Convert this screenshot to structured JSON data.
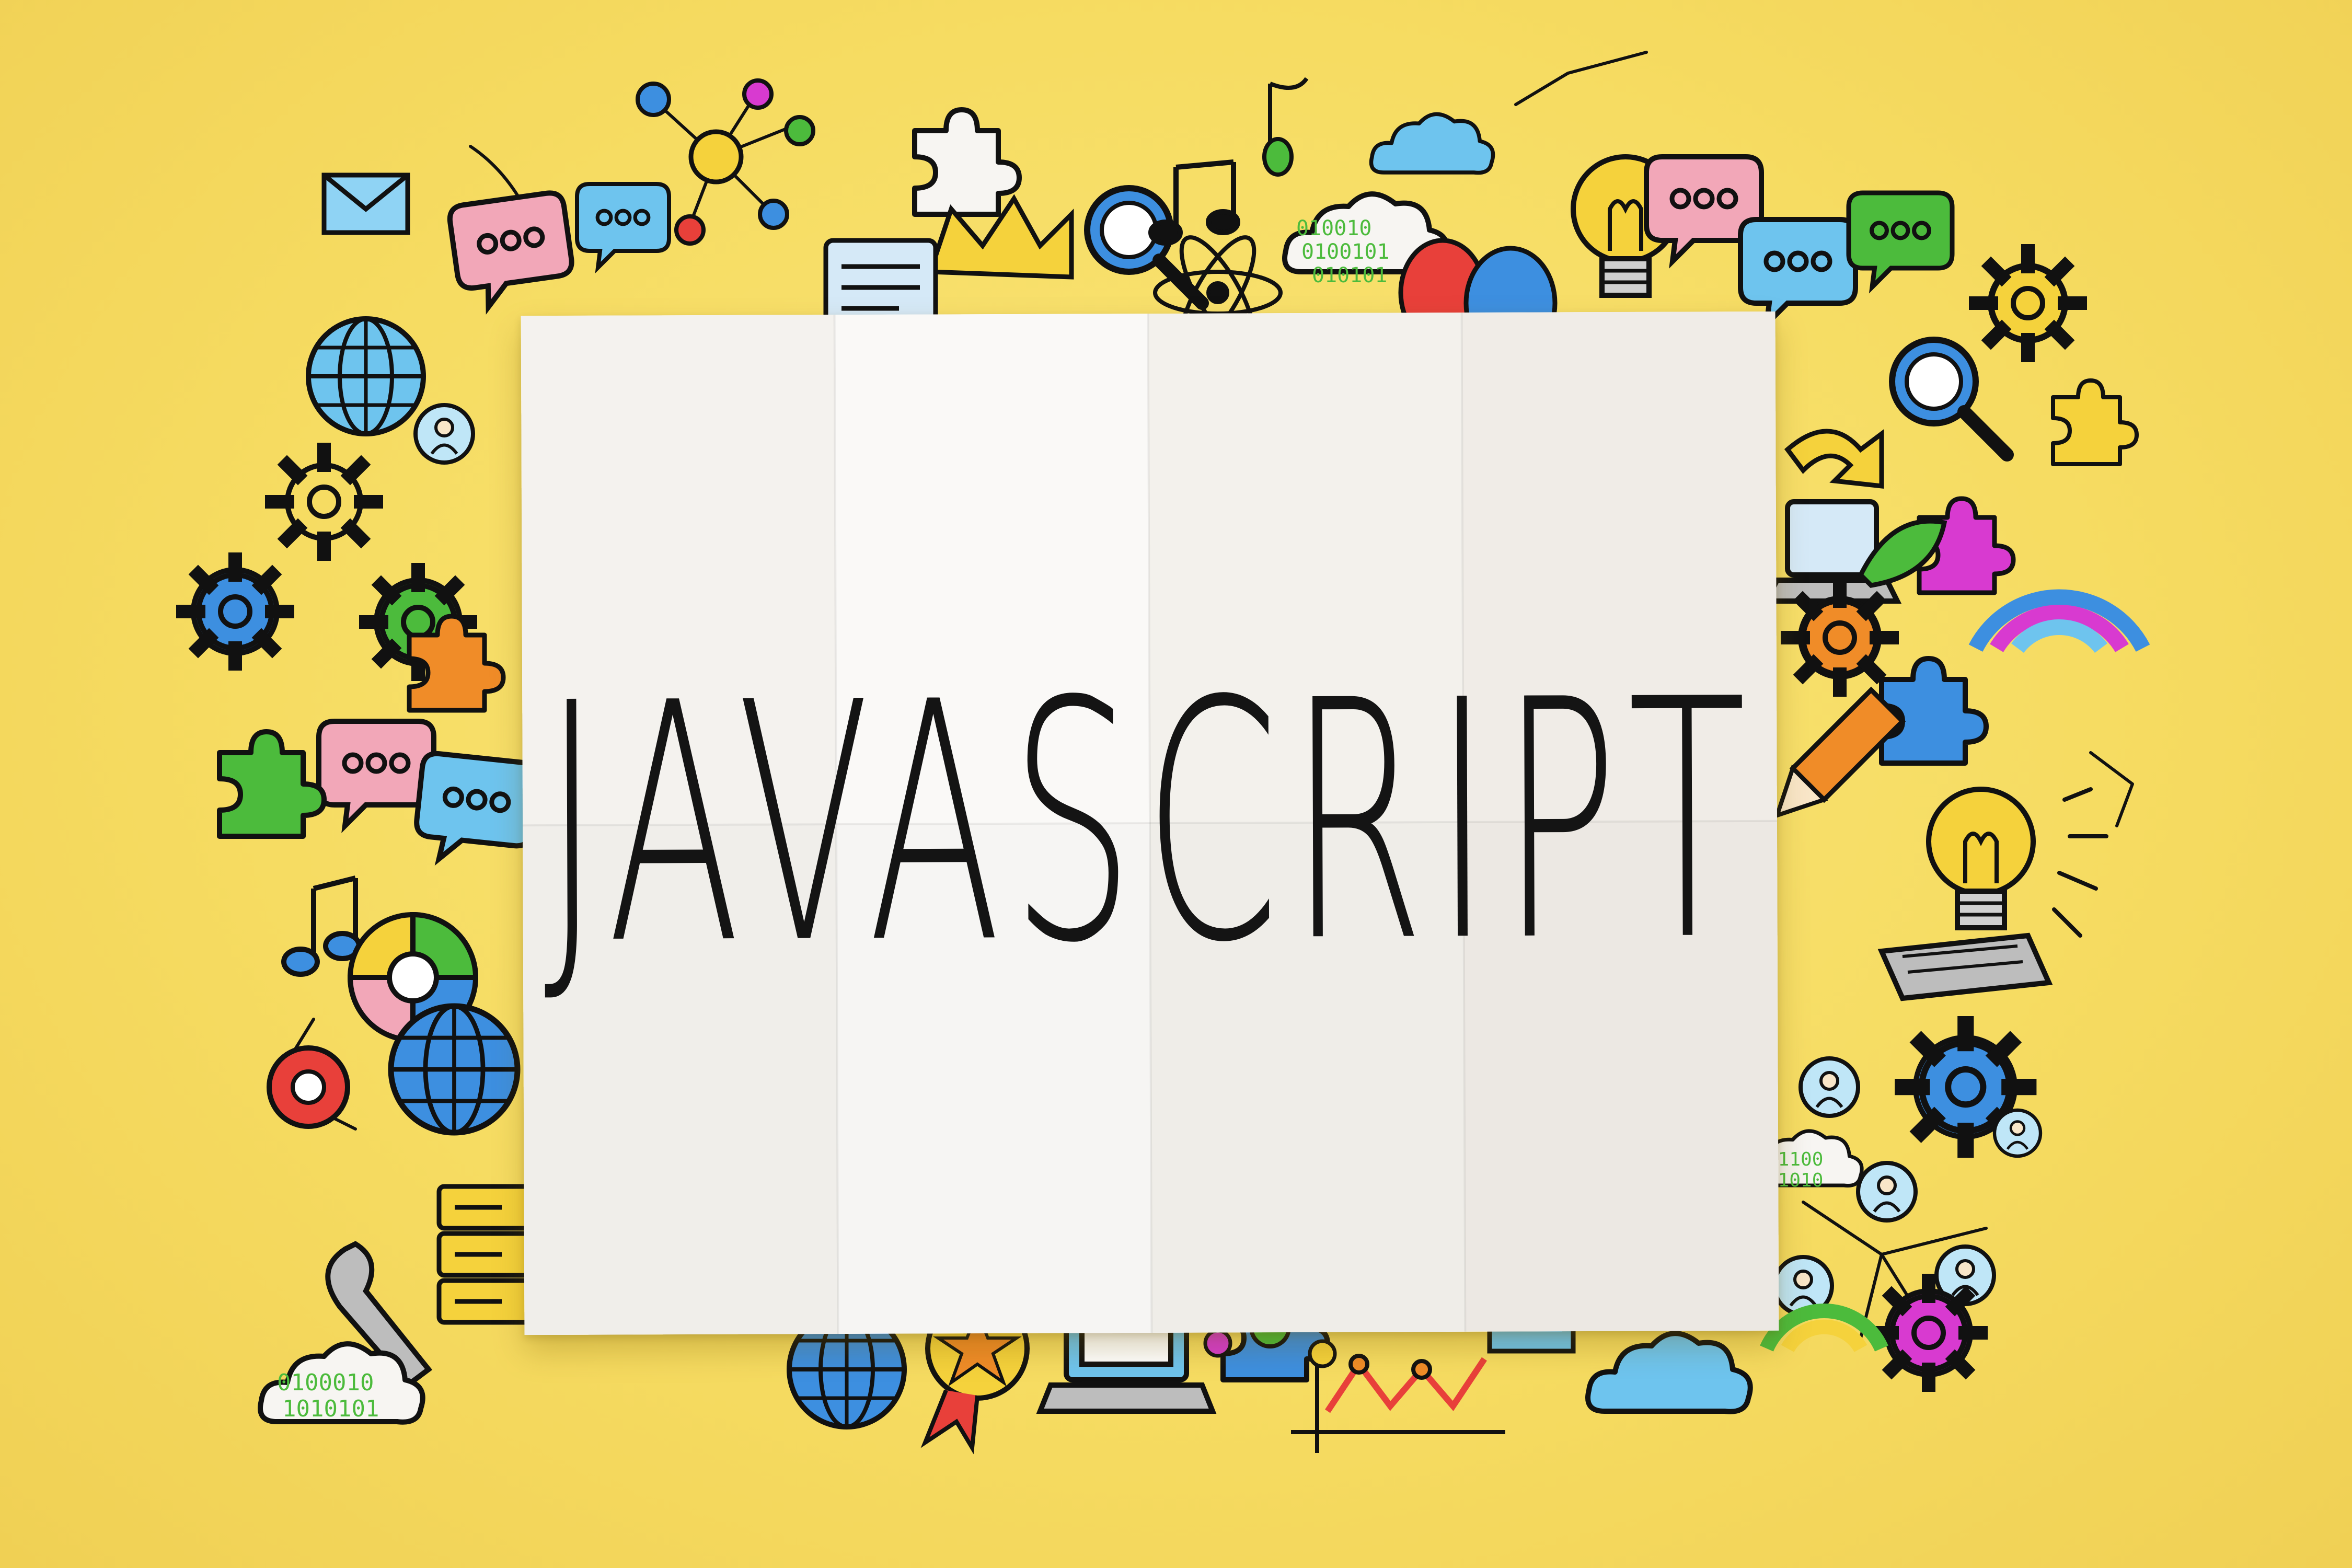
{
  "headline": "JAVASCRIPT",
  "colors": {
    "background": "#f6dc62",
    "paper": "#f7f5f2",
    "text": "#141414",
    "doodle_blue": "#3d8fe0",
    "doodle_green": "#4cbb3c",
    "doodle_red": "#e8403a",
    "doodle_pink": "#f2a7b8",
    "doodle_yellow": "#f5d23c",
    "doodle_orange": "#f08c28",
    "doodle_magenta": "#d83ad0",
    "doodle_sky": "#6ec4ee"
  },
  "doodle_icons": [
    "envelope-icon",
    "globe-icon",
    "gear-icon",
    "puzzle-piece-icon",
    "speech-bubble-icon",
    "lightbulb-icon",
    "magnifier-icon",
    "music-note-icon",
    "cloud-icon",
    "balloon-icon",
    "atom-icon",
    "network-icon",
    "pie-chart-icon",
    "server-stack-icon",
    "wrench-icon",
    "binary-cloud-icon",
    "person-icon",
    "rainbow-icon",
    "laptop-icon",
    "medal-icon",
    "line-chart-icon"
  ]
}
